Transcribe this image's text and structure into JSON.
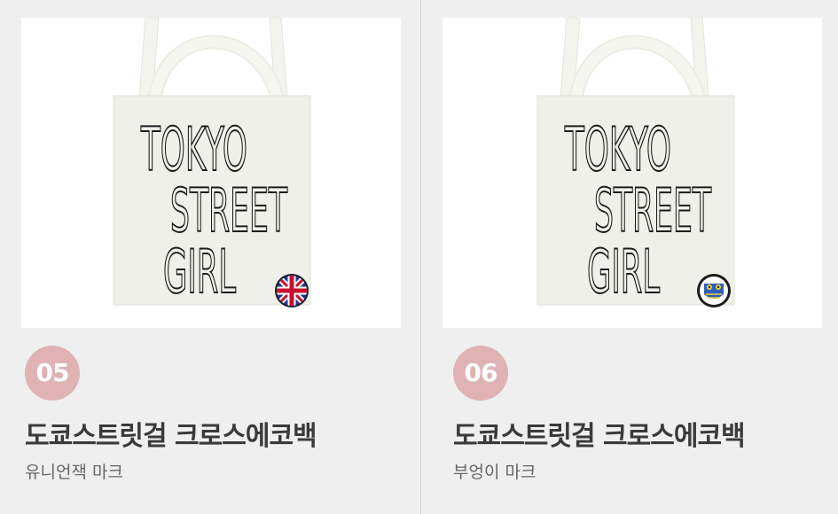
{
  "products": [
    {
      "number": "05",
      "name": "도쿄스트릿걸 크로스에코백",
      "option": "유니언잭 마크",
      "print_lines": [
        "TOKYO",
        "STREET",
        "GIRL"
      ],
      "patch_icon": "union-jack-flag",
      "badge_color": "#dfb3b3"
    },
    {
      "number": "06",
      "name": "도쿄스트릿걸 크로스에코백",
      "option": "부엉이 마크",
      "print_lines": [
        "TOKYO",
        "STREET",
        "GIRL"
      ],
      "patch_icon": "owl-emblem",
      "badge_color": "#dfb3b3"
    }
  ]
}
